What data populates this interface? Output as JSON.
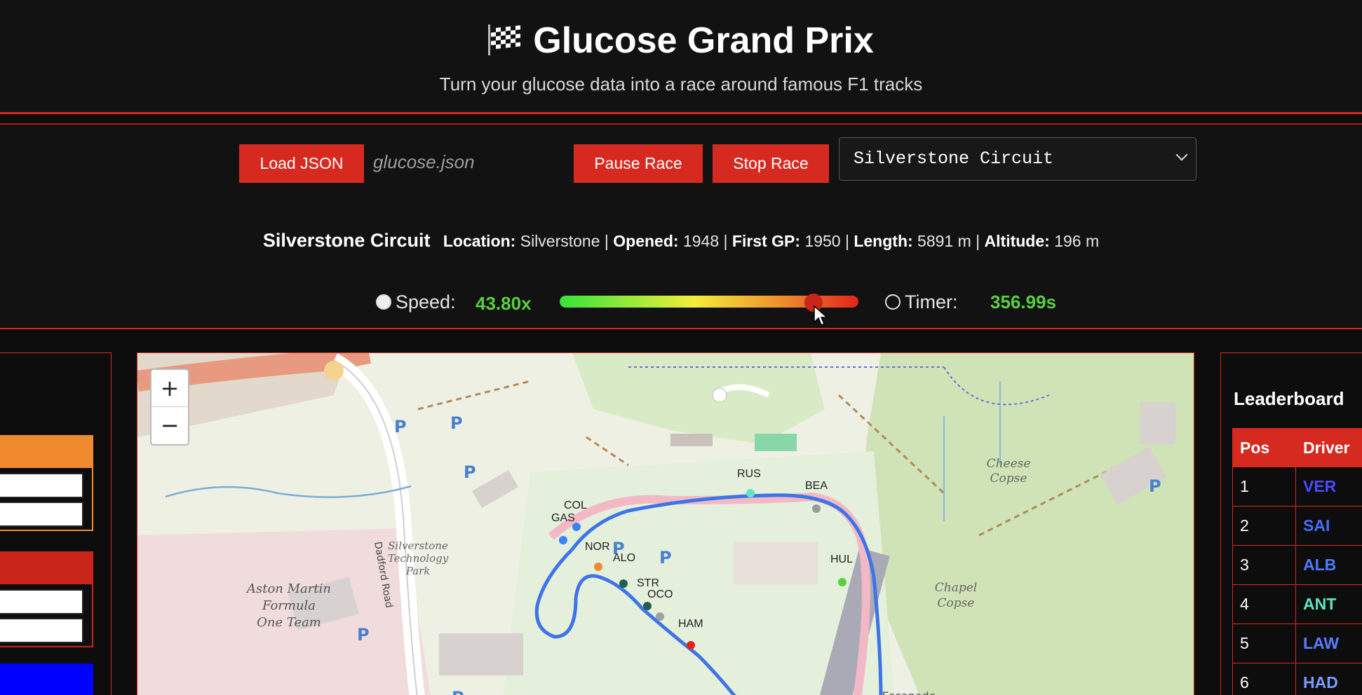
{
  "header": {
    "title": "Glucose Grand Prix",
    "subtitle": "Turn your glucose data into a race around famous F1 tracks",
    "flag_icon": "checkered-flag-icon"
  },
  "controls": {
    "load_label": "Load JSON",
    "filename": "glucose.json",
    "pause_label": "Pause Race",
    "stop_label": "Stop Race",
    "track_selected": "Silverstone Circuit",
    "accent_color": "#d62a20"
  },
  "track_info": {
    "name": "Silverstone Circuit",
    "location_label": "Location:",
    "location": "Silverstone",
    "opened_label": "Opened:",
    "opened": "1948",
    "first_gp_label": "First GP:",
    "first_gp": "1950",
    "length_label": "Length:",
    "length": "5891 m",
    "altitude_label": "Altitude:",
    "altitude": "196 m"
  },
  "speed": {
    "label": "Speed:",
    "value": "43.80x",
    "slider_fraction": 0.86
  },
  "timer": {
    "label": "Timer:",
    "value": "356.99s"
  },
  "map": {
    "zoom_in": "+",
    "zoom_out": "−",
    "place_labels": [
      "Silverstone Technology Park",
      "Aston Martin Formula One Team",
      "Dadford Road",
      "Cheese Copse",
      "Chapel Copse",
      "Escapade"
    ],
    "parking_label": "P",
    "drivers": [
      {
        "code": "RUS",
        "color": "#5fe6c0"
      },
      {
        "code": "BEA",
        "color": "#999999"
      },
      {
        "code": "COL",
        "color": "#3b82f6"
      },
      {
        "code": "GAS",
        "color": "#3b82f6"
      },
      {
        "code": "NOR",
        "color": "#f08a2f"
      },
      {
        "code": "ALO",
        "color": "#1f5f50"
      },
      {
        "code": "STR",
        "color": "#1f5f50"
      },
      {
        "code": "OCO",
        "color": "#a0a0a0"
      },
      {
        "code": "HAM",
        "color": "#e1231a"
      },
      {
        "code": "HUL",
        "color": "#57d13c"
      }
    ]
  },
  "leaderboard": {
    "title": "Leaderboard",
    "columns": [
      "Pos",
      "Driver"
    ],
    "rows": [
      {
        "pos": "1",
        "driver": "VER",
        "color": "#4a4aff"
      },
      {
        "pos": "2",
        "driver": "SAI",
        "color": "#4a6bff"
      },
      {
        "pos": "3",
        "driver": "ALB",
        "color": "#4a7bff"
      },
      {
        "pos": "4",
        "driver": "ANT",
        "color": "#5fe6c0"
      },
      {
        "pos": "5",
        "driver": "LAW",
        "color": "#5a7cff"
      },
      {
        "pos": "6",
        "driver": "HAD",
        "color": "#7a9cff"
      }
    ]
  }
}
